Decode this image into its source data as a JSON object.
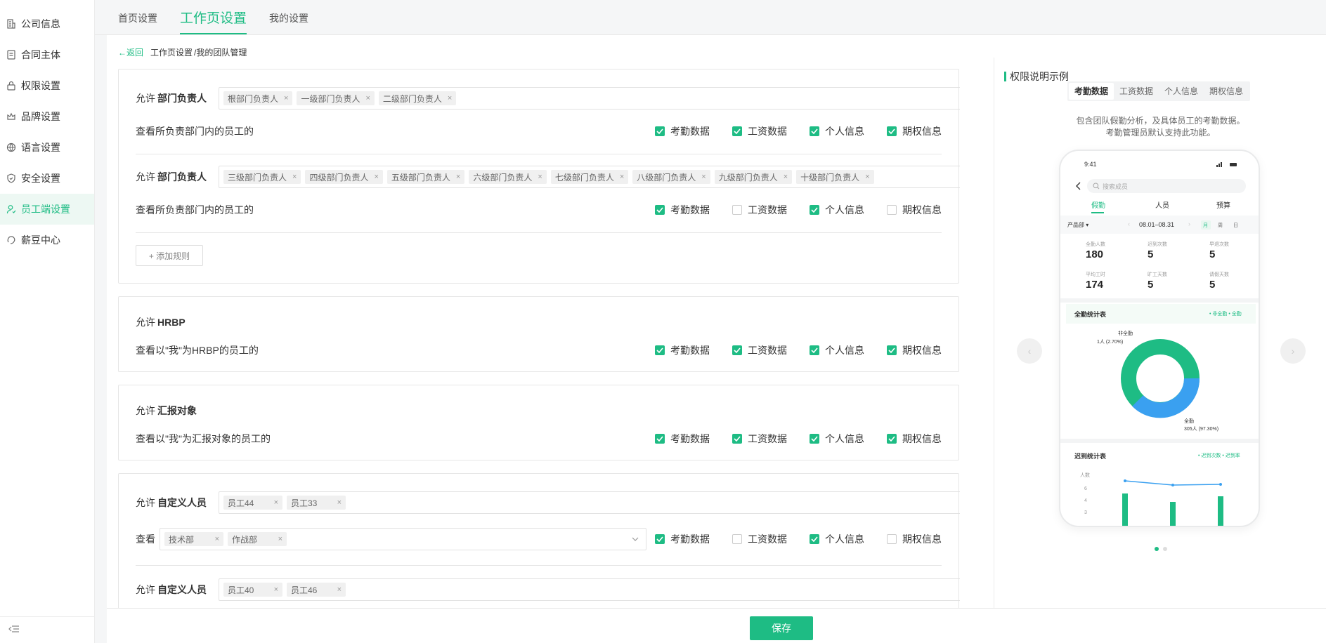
{
  "sidebar": {
    "items": [
      {
        "label": "公司信息",
        "icon": "building-icon"
      },
      {
        "label": "合同主体",
        "icon": "document-icon"
      },
      {
        "label": "权限设置",
        "icon": "lock-icon"
      },
      {
        "label": "品牌设置",
        "icon": "crown-icon"
      },
      {
        "label": "语言设置",
        "icon": "globe-icon"
      },
      {
        "label": "安全设置",
        "icon": "shield-icon"
      },
      {
        "label": "员工端设置",
        "icon": "user-icon",
        "active": true
      },
      {
        "label": "薪豆中心",
        "icon": "bean-icon"
      }
    ]
  },
  "tabs": {
    "home": "首页设置",
    "workspace": "工作页设置",
    "mine": "我的设置"
  },
  "breadcrumb": {
    "back": "←返回",
    "parent": "工作页设置",
    "current": "/我的团队管理"
  },
  "perm_labels": {
    "attendance": "考勤数据",
    "salary": "工资数据",
    "personal": "个人信息",
    "equity": "期权信息"
  },
  "rules": {
    "allow_prefix": "允许",
    "view_prefix": "查看",
    "dept_head_label": "部门负责人",
    "dept_view_text": "查看所负责部门内的员工的",
    "rule1_chips": [
      "根部门负责人",
      "一级部门负责人",
      "二级部门负责人"
    ],
    "rule2_chips": [
      "三级部门负责人",
      "四级部门负责人",
      "五级部门负责人",
      "六级部门负责人",
      "七级部门负责人",
      "八级部门负责人",
      "九级部门负责人",
      "十级部门负责人"
    ],
    "add_rule": "+ 添加规则",
    "hrbp_label": "HRBP",
    "hrbp_view_text": "查看以\"我\"为HRBP的员工的",
    "report_label": "汇报对象",
    "report_view_text": "查看以\"我\"为汇报对象的员工的",
    "custom_label": "自定义人员",
    "custom1_chips": [
      "员工44",
      "员工33"
    ],
    "custom1_dept_chips": [
      "技术部",
      "作战部"
    ],
    "custom2_chips": [
      "员工40",
      "员工46"
    ]
  },
  "right_panel": {
    "title": "权限说明示例",
    "tabs": [
      "考勤数据",
      "工资数据",
      "个人信息",
      "期权信息"
    ],
    "desc_line1": "包含团队假勤分析，及具体员工的考勤数据。",
    "desc_line2": "考勤管理员默认支持此功能。"
  },
  "phone": {
    "time": "9:41",
    "search_placeholder": "搜索成员",
    "tabs": [
      "假勤",
      "人员",
      "预算"
    ],
    "filter": "产品部 ▾",
    "date_range": "08.01–08.31",
    "period": [
      "月",
      "周",
      "日"
    ],
    "stats": [
      {
        "label": "全勤人数",
        "value": "180"
      },
      {
        "label": "迟到次数",
        "value": "5"
      },
      {
        "label": "早退次数",
        "value": "5"
      },
      {
        "label": "平均工时",
        "value": "174"
      },
      {
        "label": "旷工天数",
        "value": "5"
      },
      {
        "label": "请假天数",
        "value": "5"
      }
    ],
    "chart1_title": "全勤统计表",
    "chart1_legend": "• 非全勤 • 全勤",
    "chart1_lbl_a": "非全勤",
    "chart1_lbl_a2": "1人 (2.70%)",
    "chart1_lbl_b": "全勤",
    "chart1_lbl_b2": "305人 (97.30%)",
    "chart2_title": "迟到统计表",
    "chart2_legend": "• 迟到次数 • 迟到率",
    "chart2_ylabel": "人数",
    "chart2_ticks": [
      "6",
      "4",
      "3"
    ]
  },
  "save": "保存",
  "colors": {
    "accent": "#1ebc84",
    "blue": "#3aa0f0"
  }
}
